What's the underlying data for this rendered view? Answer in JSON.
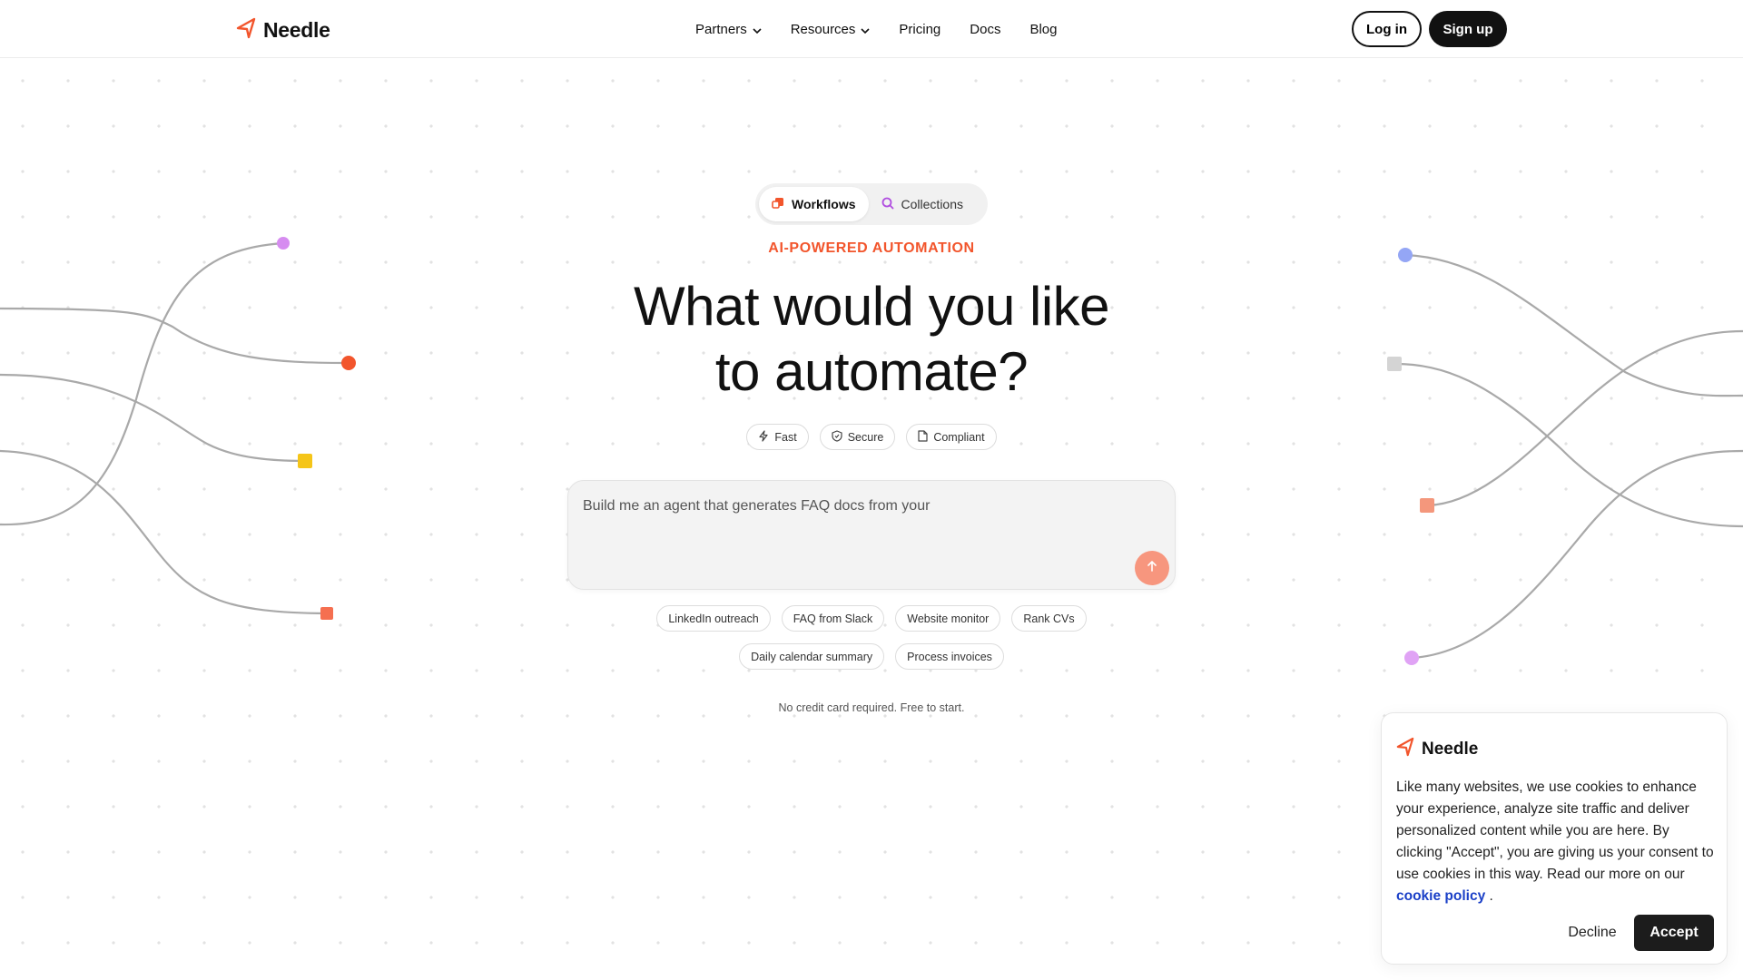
{
  "brand": {
    "name": "Needle",
    "accent": "#f2552c",
    "icon": "needle-arrow-icon"
  },
  "nav": {
    "items": [
      {
        "label": "Partners",
        "has_dropdown": true
      },
      {
        "label": "Resources",
        "has_dropdown": true
      },
      {
        "label": "Pricing",
        "has_dropdown": false
      },
      {
        "label": "Docs",
        "has_dropdown": false
      },
      {
        "label": "Blog",
        "has_dropdown": false
      }
    ],
    "login_label": "Log in",
    "signup_label": "Sign up"
  },
  "hero": {
    "tabs": [
      {
        "label": "Workflows",
        "icon": "workflows-icon",
        "active": true
      },
      {
        "label": "Collections",
        "icon": "collections-icon",
        "active": false
      }
    ],
    "eyebrow": "AI-POWERED AUTOMATION",
    "headline_line1": "What would you like",
    "headline_line2": "to automate?",
    "badges": [
      {
        "label": "Fast",
        "icon": "lightning-icon"
      },
      {
        "label": "Secure",
        "icon": "shield-icon"
      },
      {
        "label": "Compliant",
        "icon": "document-icon"
      }
    ],
    "prompt_value": "Build me an agent that generates FAQ docs from your",
    "send_icon": "arrow-up-icon",
    "chips_row1": [
      "LinkedIn outreach",
      "FAQ from Slack",
      "Website monitor",
      "Rank CVs"
    ],
    "chips_row2": [
      "Daily calendar summary",
      "Process invoices"
    ],
    "footnote": "No credit card required. Free to start."
  },
  "cookie": {
    "brand_name": "Needle",
    "text": "Like many websites, we use cookies to enhance your experience, analyze site traffic and deliver personalized content while you are here. By clicking \"Accept\", you are giving us your consent to use cookies in this way. Read our more on our",
    "link_label": "cookie policy",
    "text_end": ".",
    "decline_label": "Decline",
    "accept_label": "Accept"
  },
  "colors": {
    "accent": "#f2552c",
    "dark": "#111111",
    "link": "#1a3fc7",
    "send_button": "#f7967e"
  }
}
